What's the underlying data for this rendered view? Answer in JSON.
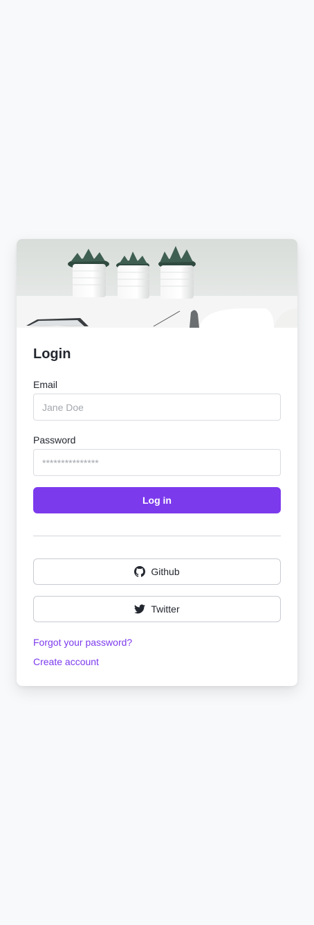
{
  "login": {
    "title": "Login",
    "email_label": "Email",
    "email_placeholder": "Jane Doe",
    "password_label": "Password",
    "password_placeholder": "***************",
    "submit_label": "Log in"
  },
  "social": {
    "github_label": "Github",
    "twitter_label": "Twitter"
  },
  "links": {
    "forgot_password": "Forgot your password?",
    "create_account": "Create account"
  },
  "colors": {
    "accent": "#7c3aed",
    "background": "#f8f9fb"
  },
  "icons": {
    "github": "github-icon",
    "twitter": "twitter-icon"
  }
}
